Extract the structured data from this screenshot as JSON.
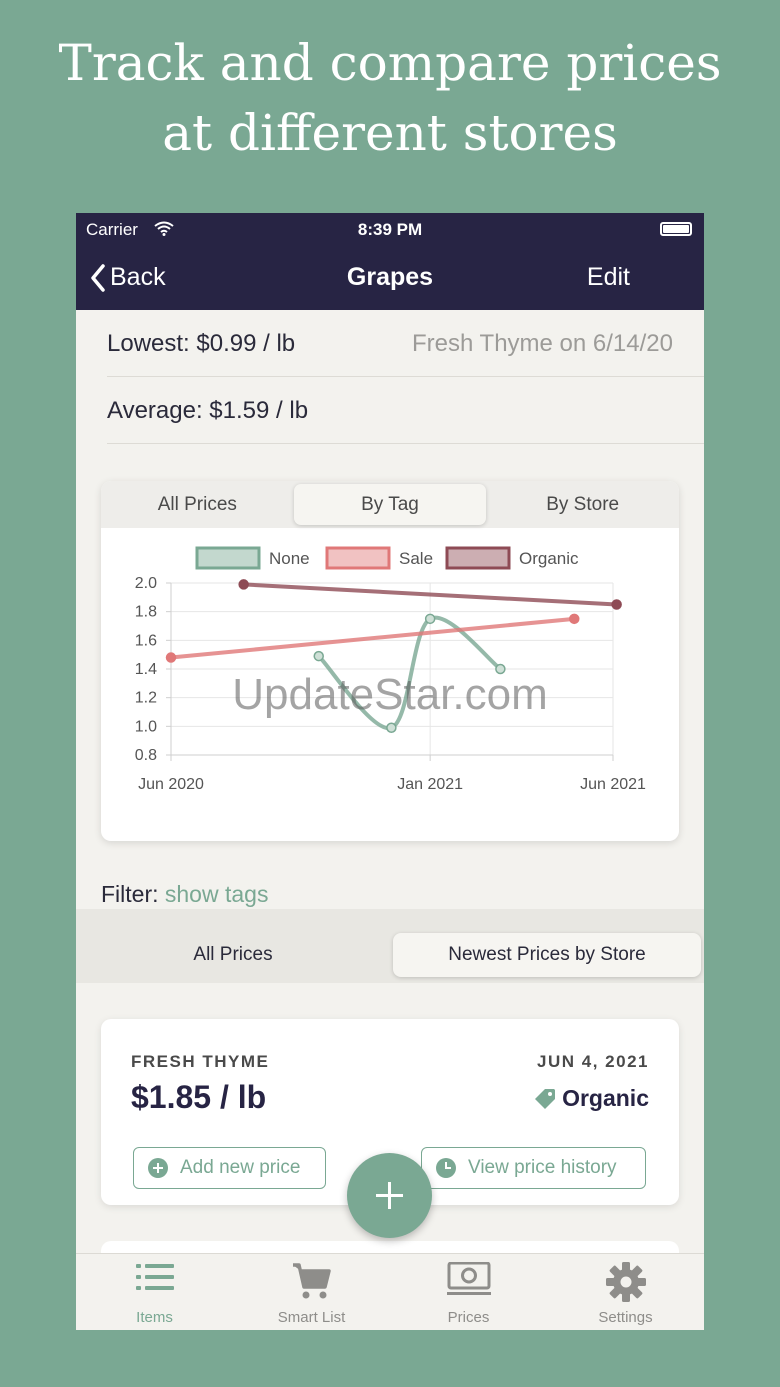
{
  "headline": {
    "line1": "Track and compare prices",
    "line2": "at different stores"
  },
  "status_bar": {
    "carrier": "Carrier",
    "time": "8:39 PM"
  },
  "nav": {
    "back_label": "Back",
    "title": "Grapes",
    "edit_label": "Edit"
  },
  "summary": {
    "lowest": "Lowest: $0.99 / lb",
    "lowest_where": "Fresh Thyme on 6/14/20",
    "average": "Average: $1.59 / lb"
  },
  "chart_tabs": [
    "All Prices",
    "By Tag",
    "By Store"
  ],
  "chart_tabs_active": 1,
  "chart_data": {
    "type": "line",
    "legend": [
      "None",
      "Sale",
      "Organic"
    ],
    "legend_position": "top",
    "x_ticks": [
      "Jun 2020",
      "Jan 2021",
      "Jun 2021"
    ],
    "y_ticks": [
      "2.0",
      "1.8",
      "1.6",
      "1.4",
      "1.2",
      "1.0",
      "0.8"
    ],
    "ylim": [
      0.8,
      2.0
    ],
    "grid": true,
    "series": [
      {
        "name": "None",
        "color": "#7aa893",
        "smooth": true,
        "points": [
          {
            "x": "2020-10-01",
            "y": 1.49
          },
          {
            "x": "2020-11-30",
            "y": 0.99
          },
          {
            "x": "2021-01-01",
            "y": 1.75
          },
          {
            "x": "2021-02-28",
            "y": 1.4
          }
        ]
      },
      {
        "name": "Sale",
        "color": "#e07878",
        "smooth": false,
        "points": [
          {
            "x": "2020-06-01",
            "y": 1.48
          },
          {
            "x": "2021-04-30",
            "y": 1.75
          }
        ]
      },
      {
        "name": "Organic",
        "color": "#8e4b55",
        "smooth": false,
        "points": [
          {
            "x": "2020-07-31",
            "y": 1.99
          },
          {
            "x": "2021-06-04",
            "y": 1.85
          }
        ]
      }
    ]
  },
  "filter": {
    "label": "Filter:",
    "link": "show tags"
  },
  "list_tabs": [
    "All Prices",
    "Newest Prices by Store"
  ],
  "list_tabs_active": 1,
  "price_entry": {
    "store": "FRESH THYME",
    "date": "JUN 4, 2021",
    "price": "$1.85 / lb",
    "tag": "Organic",
    "add_button": "Add new price",
    "history_button": "View price history"
  },
  "tabs": [
    {
      "label": "Items",
      "icon": "list-icon"
    },
    {
      "label": "Smart List",
      "icon": "cart-icon"
    },
    {
      "label": "Prices",
      "icon": "money-icon"
    },
    {
      "label": "Settings",
      "icon": "gear-icon"
    }
  ],
  "watermark": "UpdateStar.com",
  "colors": {
    "brand_dark": "#272444",
    "accent_green": "#7aa893",
    "sale_red": "#e07878",
    "organic_maroon": "#8e4b55"
  }
}
